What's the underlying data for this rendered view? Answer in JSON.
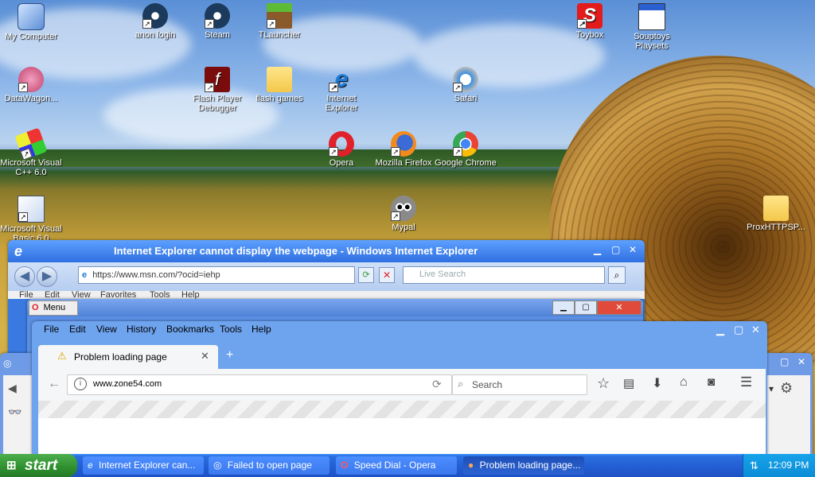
{
  "desktop": {
    "icons": [
      {
        "label": "My Computer"
      },
      {
        "label": "anon login"
      },
      {
        "label": "Steam"
      },
      {
        "label": "TLauncher"
      },
      {
        "label": "Toybox"
      },
      {
        "label": "Souptoys Playsets"
      },
      {
        "label": "DataWagon..."
      },
      {
        "label": "Flash Player Debugger"
      },
      {
        "label": "flash games"
      },
      {
        "label": "Internet Explorer"
      },
      {
        "label": "Safari"
      },
      {
        "label": "Microsoft Visual C++ 6.0"
      },
      {
        "label": "Opera"
      },
      {
        "label": "Mozilla Firefox"
      },
      {
        "label": "Google Chrome"
      },
      {
        "label": "Microsoft Visual Basic 6.0"
      },
      {
        "label": "Mypal"
      },
      {
        "label": "ProxHTTPSP..."
      }
    ]
  },
  "ie": {
    "title": "Internet Explorer cannot display the webpage - Windows Internet Explorer",
    "address": "https://www.msn.com/?ocid=iehp",
    "search_placeholder": "Live Search",
    "menu": [
      "File",
      "Edit",
      "View",
      "Favorites",
      "Tools",
      "Help"
    ]
  },
  "opera": {
    "menu_label": "Menu"
  },
  "firefox": {
    "menu": [
      "File",
      "Edit",
      "View",
      "History",
      "Bookmarks",
      "Tools",
      "Help"
    ],
    "tab_title": "Problem loading page",
    "url": "www.zone54.com",
    "search_placeholder": "Search"
  },
  "taskbar": {
    "start_label": "start",
    "tasks": [
      {
        "label": "Internet Explorer can..."
      },
      {
        "label": "Failed to open page"
      },
      {
        "label": "Speed Dial - Opera"
      },
      {
        "label": "Problem loading page..."
      }
    ],
    "clock": "12:09 PM"
  }
}
